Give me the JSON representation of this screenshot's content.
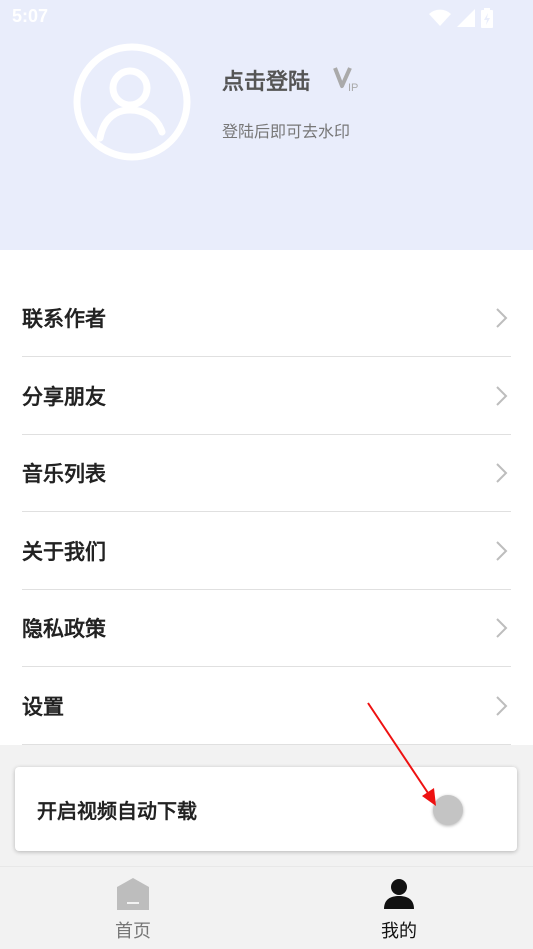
{
  "status_bar": {
    "time": "5:07"
  },
  "profile": {
    "login_title": "点击登陆",
    "login_subtitle": "登陆后即可去水印",
    "vip_badge": "IP"
  },
  "menu": {
    "items": [
      {
        "label": "联系作者"
      },
      {
        "label": "分享朋友"
      },
      {
        "label": "音乐列表"
      },
      {
        "label": "关于我们"
      },
      {
        "label": "隐私政策"
      },
      {
        "label": "设置"
      }
    ]
  },
  "auto_download": {
    "label": "开启视频自动下载",
    "enabled": false
  },
  "bottom_nav": {
    "tabs": [
      {
        "label": "首页",
        "icon": "home-icon",
        "active": false
      },
      {
        "label": "我的",
        "icon": "person-icon",
        "active": true
      }
    ]
  },
  "colors": {
    "header_bg": "#e9edfb",
    "active_tab": "#111111",
    "inactive_tab": "#777777",
    "annotation_arrow": "#ee1111"
  }
}
